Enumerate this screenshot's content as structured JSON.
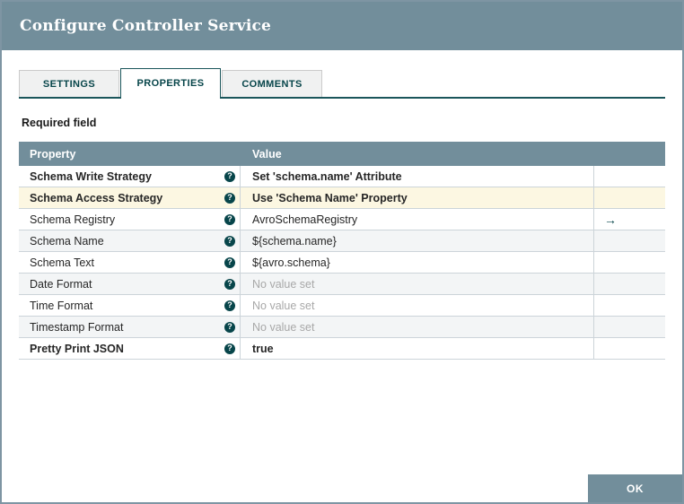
{
  "dialog": {
    "title": "Configure Controller Service",
    "ok_label": "OK",
    "required_label": "Required field"
  },
  "tabs": [
    {
      "label": "SETTINGS",
      "active": false
    },
    {
      "label": "PROPERTIES",
      "active": true
    },
    {
      "label": "COMMENTS",
      "active": false
    }
  ],
  "table": {
    "columns": {
      "property": "Property",
      "value": "Value"
    },
    "rows": [
      {
        "property": "Schema Write Strategy",
        "value": "Set 'schema.name' Attribute",
        "required": true,
        "highlighted": false,
        "goto": false
      },
      {
        "property": "Schema Access Strategy",
        "value": "Use 'Schema Name' Property",
        "required": true,
        "highlighted": true,
        "goto": false
      },
      {
        "property": "Schema Registry",
        "value": "AvroSchemaRegistry",
        "required": false,
        "highlighted": false,
        "goto": true
      },
      {
        "property": "Schema Name",
        "value": "${schema.name}",
        "required": false,
        "highlighted": false,
        "goto": false
      },
      {
        "property": "Schema Text",
        "value": "${avro.schema}",
        "required": false,
        "highlighted": false,
        "goto": false
      },
      {
        "property": "Date Format",
        "value": "No value set",
        "required": false,
        "highlighted": false,
        "goto": false
      },
      {
        "property": "Time Format",
        "value": "No value set",
        "required": false,
        "highlighted": false,
        "goto": false
      },
      {
        "property": "Timestamp Format",
        "value": "No value set",
        "required": false,
        "highlighted": false,
        "goto": false
      },
      {
        "property": "Pretty Print JSON",
        "value": "true",
        "required": true,
        "highlighted": false,
        "goto": false
      }
    ]
  },
  "icons": {
    "help_glyph": "?",
    "goto_glyph": "→"
  },
  "colors": {
    "header_bg": "#728E9B",
    "accent_teal": "#07454A",
    "row_shaded": "#F3F5F6",
    "row_highlight": "#FCF7E2",
    "muted_text": "#A8A8A8"
  }
}
